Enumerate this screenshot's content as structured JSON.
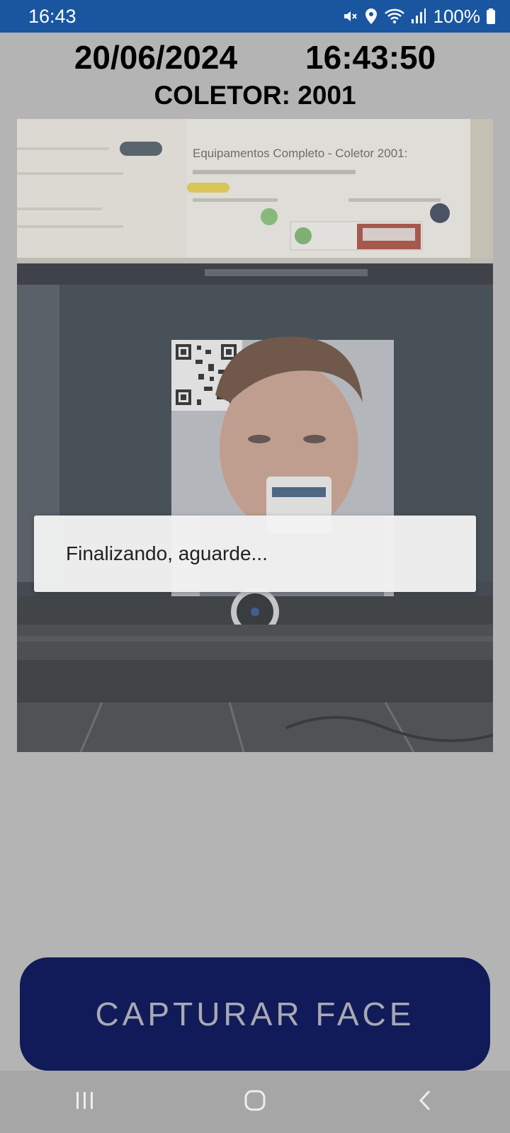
{
  "status_bar": {
    "time": "16:43",
    "battery": "100%",
    "icons": [
      "mute-icon",
      "location-icon",
      "wifi-icon",
      "signal-icon",
      "battery-icon"
    ]
  },
  "header": {
    "date": "20/06/2024",
    "clock": "16:43:50",
    "collector": "COLETOR: 2001"
  },
  "camera": {
    "screen_text": {
      "heading": "Equipamentos Completo - Coletor 2001:"
    }
  },
  "dialog": {
    "message": "Finalizando, aguarde..."
  },
  "capture_button": {
    "label": "CAPTURAR FACE"
  },
  "navigation": {
    "items": [
      "recent-apps-icon",
      "home-icon",
      "back-icon"
    ]
  },
  "colors": {
    "status_bar": "#1a56a0",
    "background": "#b4b4b4",
    "button": "#121b59",
    "button_text": "#a9a9b3"
  }
}
